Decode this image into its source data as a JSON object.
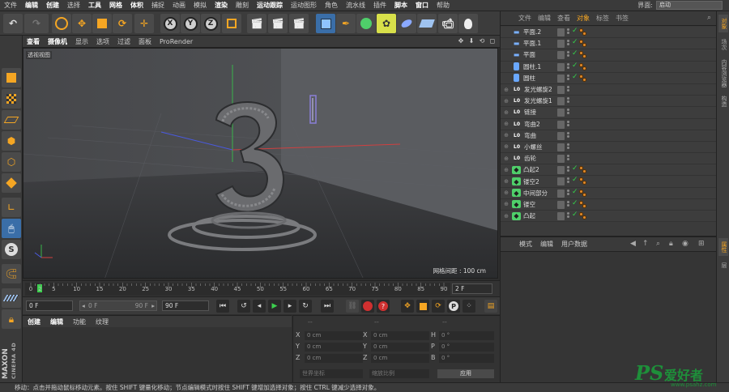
{
  "menubar": {
    "items": [
      "文件",
      "编辑",
      "创建",
      "选择",
      "工具",
      "网格",
      "体积",
      "捕捉",
      "动画",
      "模拟",
      "渲染",
      "雕刻",
      "运动跟踪",
      "运动图形",
      "角色",
      "流水线",
      "插件",
      "脚本",
      "窗口",
      "帮助"
    ],
    "layout_label": "界面:",
    "layout_value": "启动"
  },
  "toolbar": {
    "x_label": "X",
    "y_label": "Y",
    "z_label": "Z"
  },
  "viewport_menu": {
    "items": [
      "查看",
      "摄像机",
      "显示",
      "选项",
      "过滤",
      "面板",
      "ProRender"
    ]
  },
  "viewport": {
    "view_label": "透视视图",
    "grid_spacing": "网格间距 : 100 cm"
  },
  "timeline": {
    "ticks": [
      "0",
      "2",
      "5",
      "10",
      "15",
      "20",
      "25",
      "30",
      "35",
      "40",
      "45",
      "50",
      "55",
      "60",
      "65",
      "70",
      "75",
      "80",
      "85",
      "90"
    ],
    "current_frame": "2 F"
  },
  "transport": {
    "start_frame": "0 F",
    "range_start": "0 F",
    "range_end": "90 F",
    "end_frame": "90 F"
  },
  "material_panel": {
    "menu": [
      "创建",
      "编辑",
      "功能",
      "纹理"
    ]
  },
  "coord_panel": {
    "header_a": "--",
    "header_b": "--",
    "header_c": "--",
    "rows": [
      {
        "l1": "X",
        "v1": "0 cm",
        "l2": "X",
        "v2": "0 cm",
        "l3": "H",
        "v3": "0 °"
      },
      {
        "l1": "Y",
        "v1": "0 cm",
        "l2": "Y",
        "v2": "0 cm",
        "l3": "P",
        "v3": "0 °"
      },
      {
        "l1": "Z",
        "v1": "0 cm",
        "l2": "Z",
        "v2": "0 cm",
        "l3": "B",
        "v3": "0 °"
      }
    ],
    "mode_select": "世界坐标",
    "scale_select": "缩放比例",
    "apply_button": "应用"
  },
  "object_manager": {
    "menu": [
      "文件",
      "编辑",
      "查看",
      "对象",
      "标签",
      "书签"
    ],
    "active_menu": "对象",
    "objects": [
      {
        "name": "平面.2",
        "type": "plane",
        "checked": true,
        "tags": 2
      },
      {
        "name": "平面.1",
        "type": "plane",
        "checked": true,
        "tags": 2
      },
      {
        "name": "平面",
        "type": "plane",
        "checked": true,
        "tags": 2
      },
      {
        "name": "圆柱.1",
        "type": "cyl",
        "checked": true,
        "tags": 2
      },
      {
        "name": "圆柱",
        "type": "cyl",
        "checked": true,
        "tags": 2
      },
      {
        "name": "发光螺旋2",
        "type": "spline",
        "checked": false,
        "tags": 0
      },
      {
        "name": "发光螺旋1",
        "type": "spline",
        "checked": false,
        "tags": 0
      },
      {
        "name": "链接",
        "type": "spline",
        "checked": false,
        "tags": 0
      },
      {
        "name": "弯曲2",
        "type": "spline",
        "checked": false,
        "tags": 0
      },
      {
        "name": "弯曲",
        "type": "spline",
        "checked": false,
        "tags": 0
      },
      {
        "name": "小螺丝",
        "type": "spline",
        "checked": false,
        "tags": 0
      },
      {
        "name": "齿轮",
        "type": "spline",
        "checked": false,
        "tags": 0
      },
      {
        "name": "凸起2",
        "type": "gen",
        "checked": true,
        "tags": 2
      },
      {
        "name": "镂空2",
        "type": "gen",
        "checked": true,
        "tags": 2
      },
      {
        "name": "中间部分",
        "type": "gen",
        "checked": true,
        "tags": 2
      },
      {
        "name": "镂空",
        "type": "gen",
        "checked": true,
        "tags": 2
      },
      {
        "name": "凸起",
        "type": "gen",
        "checked": true,
        "tags": 2
      }
    ]
  },
  "attribute_manager": {
    "menu": [
      "模式",
      "编辑",
      "用户数据"
    ]
  },
  "right_tabs": [
    "对象",
    "场次",
    "内容浏览器",
    "构造",
    "属性",
    "层"
  ],
  "statusbar": {
    "text": "移动：点击并拖动鼠标移动元素。按住 SHIFT 键量化移动；节点编辑模式时按住 SHIFT 键增加选择对象；按住 CTRL 键减少选择对象。"
  },
  "watermark": {
    "ps": "PS",
    "cn": "爱好者",
    "url": "www.psahz.com"
  },
  "colors": {
    "accent": "#f5a623",
    "selection_blue": "#3a6ea8",
    "check_green": "#35d04a"
  }
}
